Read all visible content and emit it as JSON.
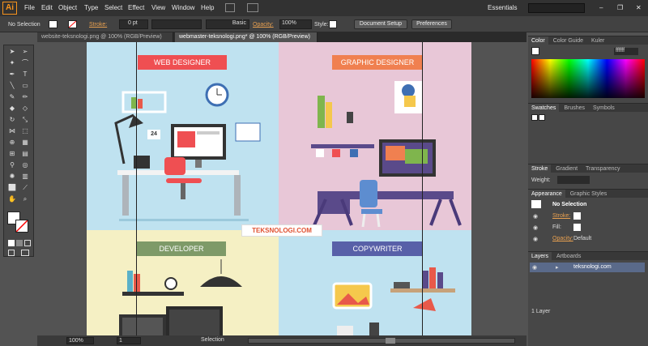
{
  "app": {
    "logo": "Ai",
    "workspace": "Essentials"
  },
  "menu": [
    "File",
    "Edit",
    "Object",
    "Type",
    "Select",
    "Effect",
    "View",
    "Window",
    "Help"
  ],
  "control": {
    "selection": "No Selection",
    "stroke_label": "Stroke:",
    "stroke_value": "0 pt",
    "brush": "Basic",
    "opacity_label": "Opacity:",
    "opacity_value": "100%",
    "style_label": "Style:",
    "doc_setup": "Document Setup",
    "prefs": "Preferences"
  },
  "tabs": [
    "website-teksnologi.png @ 100% (RGB/Preview)",
    "webmaster-teksnologi.png* @ 100% (RGB/Preview)"
  ],
  "art": {
    "q1": "WEB DESIGNER",
    "q2": "GRAPHIC DESIGNER",
    "q3": "DEVELOPER",
    "q4": "COPYWRITER",
    "watermark": "TEKSNOLOGI.COM",
    "calendar": "24"
  },
  "status": {
    "zoom": "100%",
    "page": "1",
    "mode": "Selection"
  },
  "panels": {
    "color_tabs": [
      "Color",
      "Color Guide",
      "Kuler"
    ],
    "hex": "ffffff",
    "swatch_tabs": [
      "Swatches",
      "Brushes",
      "Symbols"
    ],
    "stroke_tabs": [
      "Stroke",
      "Gradient",
      "Transparency"
    ],
    "weight": "Weight:",
    "appearance_tabs": [
      "Appearance",
      "Graphic Styles"
    ],
    "appearance_title": "No Selection",
    "app_stroke": "Stroke:",
    "app_fill": "Fill:",
    "app_opacity": "Opacity:",
    "app_opacity_val": "Default",
    "layers_tabs": [
      "Layers",
      "Artboards"
    ],
    "layer_name": "teksnologi.com",
    "layer_count": "1 Layer"
  },
  "colors": {
    "web": "#ef4f52",
    "graphic": "#f08050",
    "dev": "#7e9a68",
    "copy": "#5860a8"
  }
}
